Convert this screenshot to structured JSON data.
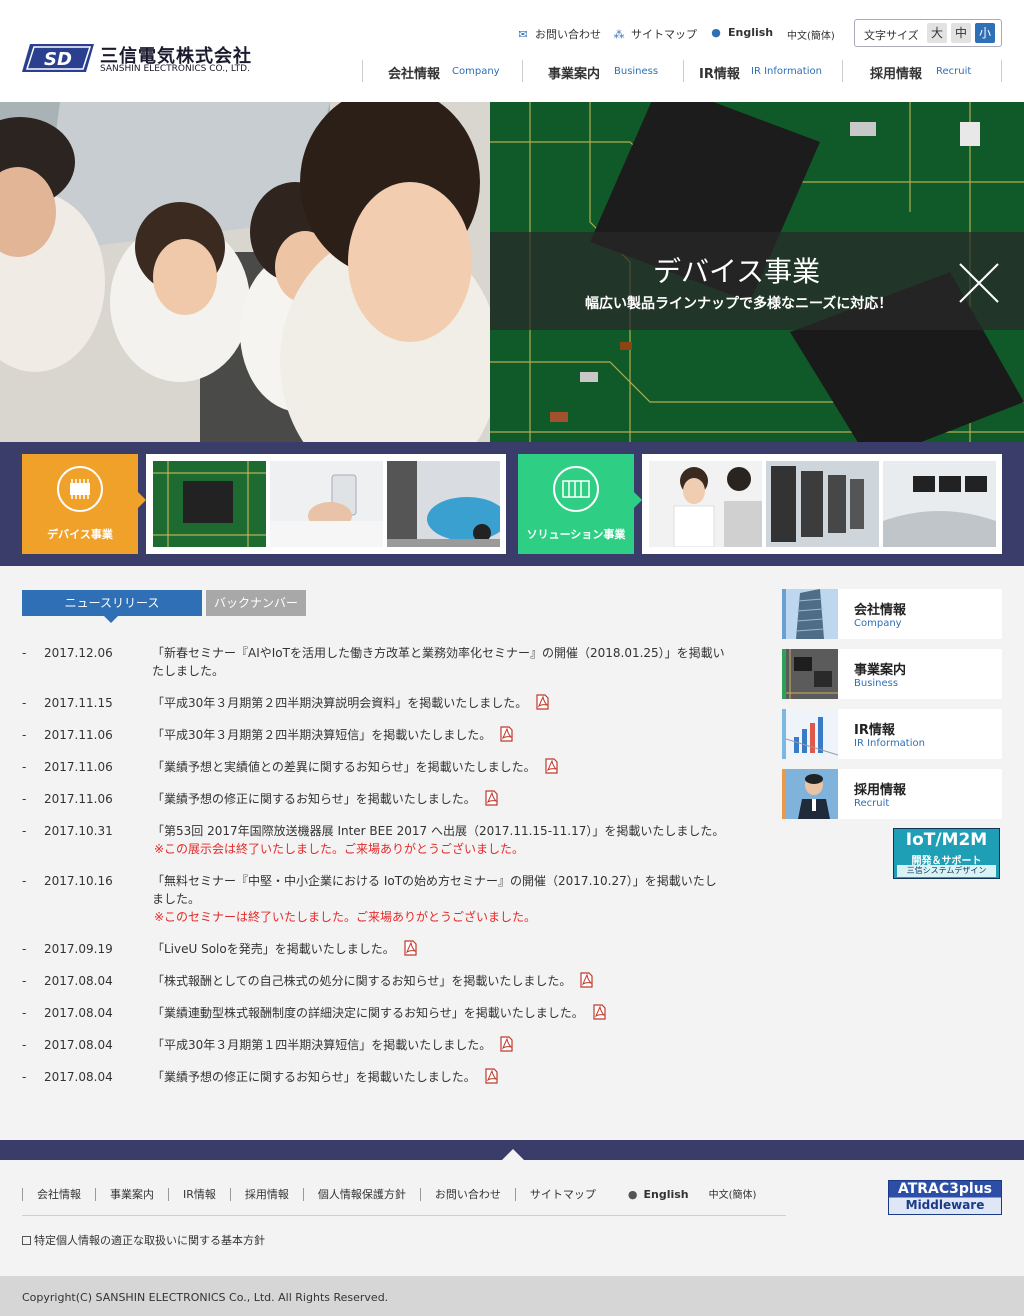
{
  "header": {
    "logo_jp": "三信電気株式会社",
    "logo_en": "SANSHIN ELECTRONICS CO., LTD.",
    "util": {
      "contact": "お問い合わせ",
      "sitemap": "サイトマップ",
      "english": "English",
      "chinese": "中文(簡体)"
    },
    "fontsize": {
      "label": "文字サイズ",
      "large": "大",
      "medium": "中",
      "small": "小"
    },
    "nav": [
      {
        "jp": "会社情報",
        "en": "Company"
      },
      {
        "jp": "事業案内",
        "en": "Business"
      },
      {
        "jp": "IR情報",
        "en": "IR Information"
      },
      {
        "jp": "採用情報",
        "en": "Recruit"
      }
    ]
  },
  "hero": {
    "title": "デバイス事業",
    "subtitle": "幅広い製品ラインナップで多様なニーズに対応！"
  },
  "categories": {
    "device": "デバイス事業",
    "solution": "ソリューション事業"
  },
  "news": {
    "tab_active": "ニュースリリース",
    "tab_back": "バックナンバー",
    "items": [
      {
        "date": "2017.12.06",
        "text": "「新春セミナー『AIやIoTを活用した働き方改革と業務効率化セミナー』の開催（2018.01.25）」を掲載いたしました。",
        "note": "",
        "pdf": false
      },
      {
        "date": "2017.11.15",
        "text": "「平成30年３月期第２四半期決算説明会資料」を掲載いたしました。",
        "note": "",
        "pdf": true
      },
      {
        "date": "2017.11.06",
        "text": "「平成30年３月期第２四半期決算短信」を掲載いたしました。",
        "note": "",
        "pdf": true
      },
      {
        "date": "2017.11.06",
        "text": "「業績予想と実績値との差異に関するお知らせ」を掲載いたしました。",
        "note": "",
        "pdf": true
      },
      {
        "date": "2017.11.06",
        "text": "「業績予想の修正に関するお知らせ」を掲載いたしました。",
        "note": "",
        "pdf": true
      },
      {
        "date": "2017.10.31",
        "text": "「第53回 2017年国際放送機器展 Inter BEE 2017 へ出展（2017.11.15-11.17）」を掲載いたしました。",
        "note": "※この展示会は終了いたしました。ご来場ありがとうございました。",
        "pdf": false
      },
      {
        "date": "2017.10.16",
        "text": "「無料セミナー『中堅・中小企業における IoTの始め方セミナー』の開催（2017.10.27）」を掲載いたしました。",
        "note": "※このセミナーは終了いたしました。ご来場ありがとうございました。",
        "pdf": false
      },
      {
        "date": "2017.09.19",
        "text": "「LiveU Soloを発売」を掲載いたしました。",
        "note": "",
        "pdf": true
      },
      {
        "date": "2017.08.04",
        "text": "「株式報酬としての自己株式の処分に関するお知らせ」を掲載いたしました。",
        "note": "",
        "pdf": true
      },
      {
        "date": "2017.08.04",
        "text": "「業績連動型株式報酬制度の詳細決定に関するお知らせ」を掲載いたしました。",
        "note": "",
        "pdf": true
      },
      {
        "date": "2017.08.04",
        "text": "「平成30年３月期第１四半期決算短信」を掲載いたしました。",
        "note": "",
        "pdf": true
      },
      {
        "date": "2017.08.04",
        "text": "「業績予想の修正に関するお知らせ」を掲載いたしました。",
        "note": "",
        "pdf": true
      }
    ]
  },
  "side": [
    {
      "jp": "会社情報",
      "en": "Company"
    },
    {
      "jp": "事業案内",
      "en": "Business"
    },
    {
      "jp": "IR情報",
      "en": "IR Information"
    },
    {
      "jp": "採用情報",
      "en": "Recruit"
    }
  ],
  "banner_iot": {
    "line1": "IoT/M2M",
    "line2": "開発＆サポート",
    "line3": "三信システムデザイン"
  },
  "footer": {
    "nav": [
      "会社情報",
      "事業案内",
      "IR情報",
      "採用情報",
      "個人情報保護方針",
      "お問い合わせ",
      "サイトマップ"
    ],
    "english": "English",
    "chinese": "中文(簡体)",
    "policy": "特定個人情報の適正な取扱いに関する基本方針",
    "atrac_line1": "ATRAC3plus",
    "atrac_line2": "Middleware",
    "copyright": "Copyright(C) SANSHIN ELECTRONICS Co., Ltd. All Rights Reserved."
  },
  "colors": {
    "accent_blue": "#2f6fb5",
    "band_navy": "#3a3d6a",
    "device_orange": "#f0a12a",
    "solution_green": "#2ecf84",
    "note_red": "#e52a2a"
  }
}
